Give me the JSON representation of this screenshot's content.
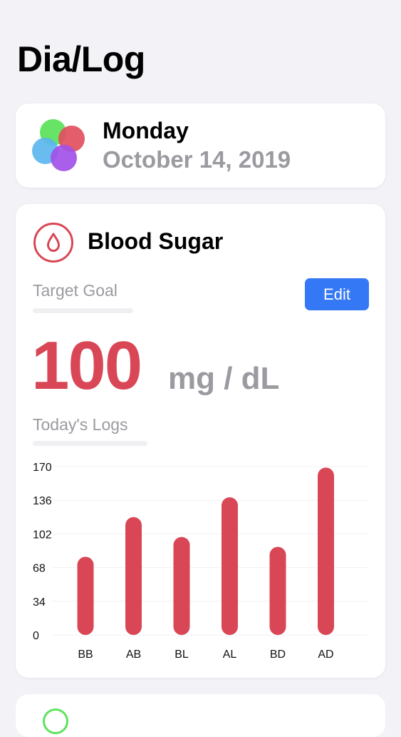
{
  "app": {
    "title": "Dia/Log"
  },
  "date_card": {
    "day": "Monday",
    "date": "October 14, 2019",
    "logo_colors": [
      "#5fe35e",
      "#e14f5d",
      "#5cb6ee",
      "#a251e8"
    ]
  },
  "blood_sugar": {
    "icon": "blood-drop-icon",
    "title": "Blood Sugar",
    "target_label": "Target Goal",
    "edit_label": "Edit",
    "goal_value": "100",
    "goal_unit": "mg / dL",
    "logs_label": "Today's Logs",
    "accent_color": "#d94756"
  },
  "chart_data": {
    "type": "bar",
    "categories": [
      "BB",
      "AB",
      "BL",
      "AL",
      "BD",
      "AD"
    ],
    "values": [
      79,
      119,
      99,
      139,
      89,
      169
    ],
    "yticks": [
      0,
      34,
      68,
      102,
      136,
      170
    ],
    "ylim": [
      0,
      170
    ],
    "grid": true,
    "color": "#d94756"
  }
}
